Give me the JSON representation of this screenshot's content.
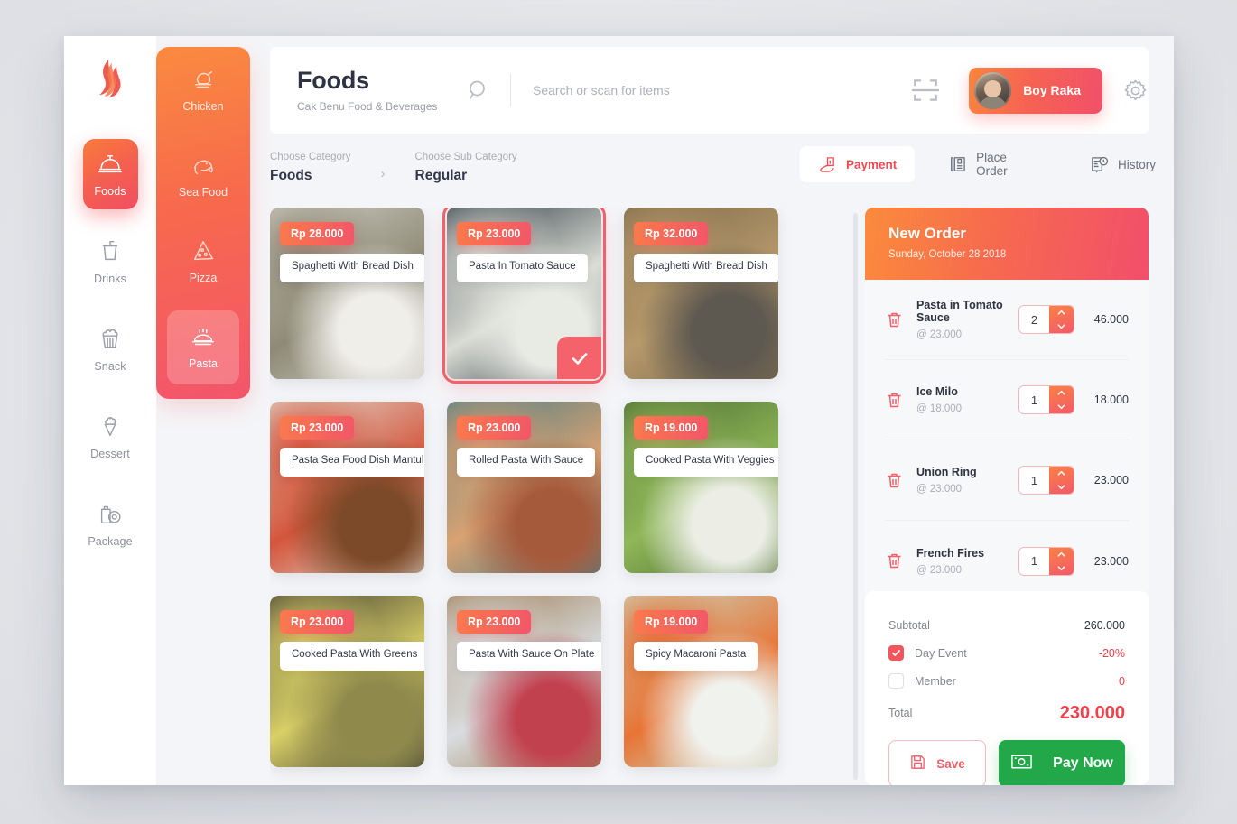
{
  "app": {
    "logo_icon": "flame-logo"
  },
  "sidebar": {
    "items": [
      {
        "label": "Foods",
        "icon": "food-dome-icon",
        "active": true
      },
      {
        "label": "Drinks",
        "icon": "drink-cup-icon",
        "active": false
      },
      {
        "label": "Snack",
        "icon": "popcorn-icon",
        "active": false
      },
      {
        "label": "Dessert",
        "icon": "ice-cream-icon",
        "active": false
      },
      {
        "label": "Package",
        "icon": "package-icon",
        "active": false
      }
    ]
  },
  "subcategory": {
    "items": [
      {
        "label": "Chicken",
        "icon": "chicken-icon",
        "active": false
      },
      {
        "label": "Sea Food",
        "icon": "fish-icon",
        "active": false
      },
      {
        "label": "Pizza",
        "icon": "pizza-icon",
        "active": false
      },
      {
        "label": "Pasta",
        "icon": "pasta-icon",
        "active": true
      }
    ]
  },
  "header": {
    "title": "Foods",
    "subtitle": "Cak Benu Food & Beverages",
    "search_placeholder": "Search or scan for items",
    "search_value": "",
    "search_icon": "search-icon",
    "scan_icon": "barcode-scan-icon",
    "settings_icon": "gear-icon",
    "user_name": "Boy Raka"
  },
  "breadcrumb": {
    "category_caption": "Choose Category",
    "category_value": "Foods",
    "separator": "›",
    "subcategory_caption": "Choose Sub Category",
    "subcategory_value": "Regular"
  },
  "panel_tabs": [
    {
      "label": "Payment",
      "icon": "hand-payment-icon",
      "active": true
    },
    {
      "label": "Place Order",
      "icon": "clipboard-icon",
      "active": false
    },
    {
      "label": "History",
      "icon": "history-clock-icon",
      "active": false
    }
  ],
  "products": [
    {
      "price": "Rp 28.000",
      "name": "Spaghetti With Bread Dish",
      "selected": false,
      "c1": "#cfcbc2",
      "c2": "#8e8a76",
      "c3": "#efeee9"
    },
    {
      "price": "Rp 23.000",
      "name": "Pasta In Tomato Sauce",
      "selected": true,
      "c1": "#2f3b42",
      "c2": "#d9dbd4",
      "c3": "#e8eae4"
    },
    {
      "price": "Rp 32.000",
      "name": "Spaghetti With Bread Dish",
      "selected": false,
      "c1": "#7d6a4c",
      "c2": "#b79a6b",
      "c3": "#5d5850"
    },
    {
      "price": "Rp 23.000",
      "name": "Pasta Sea Food Dish Mantul",
      "selected": false,
      "c1": "#e0dcd2",
      "c2": "#d4553a",
      "c3": "#7c4a28"
    },
    {
      "price": "Rp 23.000",
      "name": "Rolled Pasta With Sauce",
      "selected": false,
      "c1": "#4a7e86",
      "c2": "#d9a272",
      "c3": "#a65a3c"
    },
    {
      "price": "Rp 19.000",
      "name": "Cooked Pasta With Veggies",
      "selected": false,
      "c1": "#4c6b31",
      "c2": "#8fb858",
      "c3": "#eceee6"
    },
    {
      "price": "Rp 23.000",
      "name": "Cooked Pasta With Greens",
      "selected": false,
      "c1": "#3d3a33",
      "c2": "#d9d066",
      "c3": "#8f8a4c"
    },
    {
      "price": "Rp 23.000",
      "name": "Pasta With Sauce On Plate",
      "selected": false,
      "c1": "#9d7a4f",
      "c2": "#d9dde0",
      "c3": "#c2414f"
    },
    {
      "price": "Rp 19.000",
      "name": "Spicy Macaroni Pasta",
      "selected": false,
      "c1": "#c9d6c0",
      "c2": "#e87434",
      "c3": "#f0f2ee"
    }
  ],
  "order": {
    "title": "New Order",
    "date": "Sunday, October 28 2018",
    "items": [
      {
        "name": "Pasta in Tomato Sauce",
        "unit": "@ 23.000",
        "qty": "2",
        "total": "46.000"
      },
      {
        "name": "Ice Milo",
        "unit": "@ 18.000",
        "qty": "1",
        "total": "18.000"
      },
      {
        "name": "Union Ring",
        "unit": "@ 23.000",
        "qty": "1",
        "total": "23.000"
      },
      {
        "name": "French Fires",
        "unit": "@ 23.000",
        "qty": "1",
        "total": "23.000"
      }
    ],
    "summary": {
      "subtotal_label": "Subtotal",
      "subtotal_value": "260.000",
      "day_event_label": "Day Event",
      "day_event_value": "-20%",
      "day_event_checked": true,
      "member_label": "Member",
      "member_value": "0",
      "member_checked": false,
      "total_label": "Total",
      "total_value": "230.000"
    },
    "save_label": "Save",
    "save_icon": "floppy-save-icon",
    "pay_label": "Pay Now",
    "pay_icon": "money-bill-icon"
  },
  "colors": {
    "accent_start": "#fa8b3c",
    "accent_end": "#f24f6b",
    "red": "#f2414c",
    "green": "#22a848",
    "bg": "#f4f5f8"
  }
}
